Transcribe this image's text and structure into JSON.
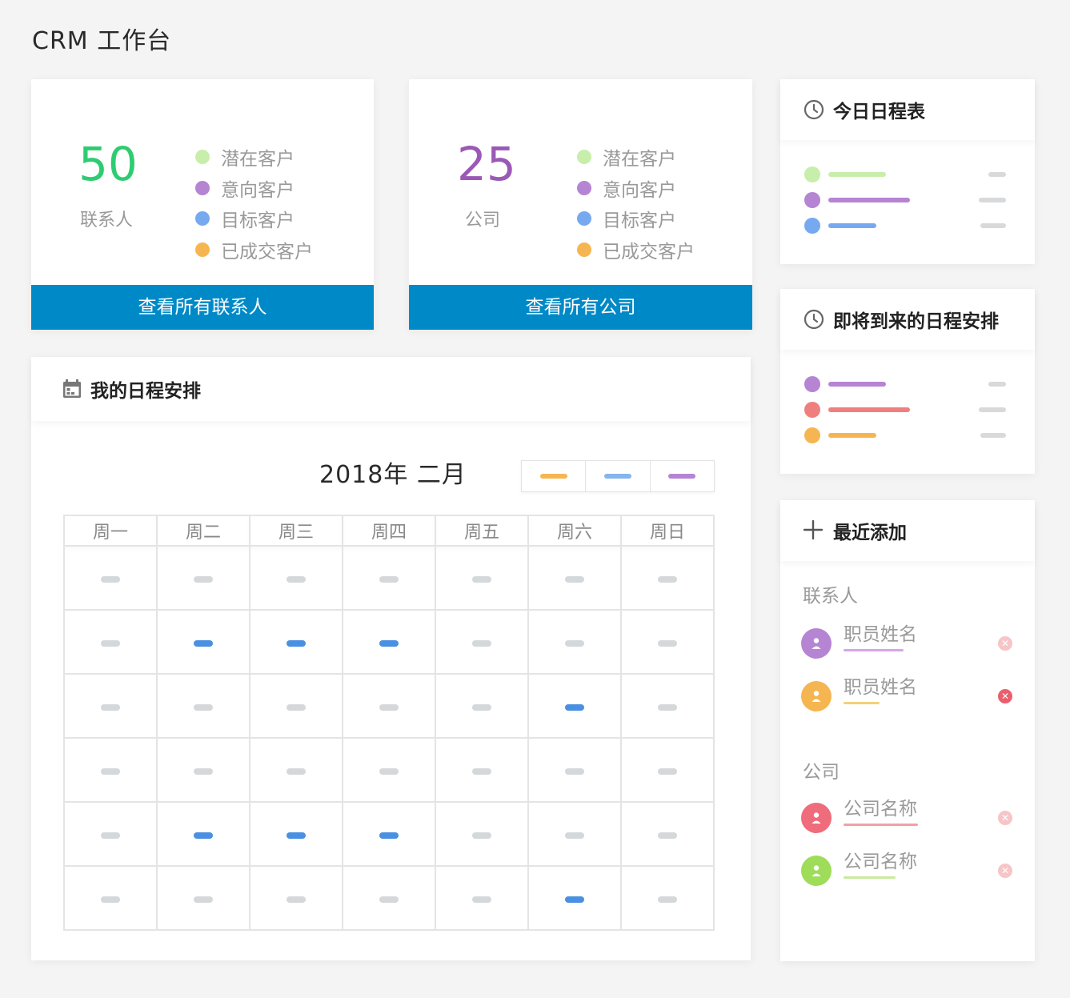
{
  "app": {
    "title": "CRM 工作台"
  },
  "contacts_card": {
    "count": "50",
    "label": "联系人",
    "count_color": "#2ecc71",
    "legend": [
      {
        "label": "潜在客户",
        "color": "#c8eeab"
      },
      {
        "label": "意向客户",
        "color": "#b584d3"
      },
      {
        "label": "目标客户",
        "color": "#76a9f0"
      },
      {
        "label": "已成交客户",
        "color": "#f5b652"
      }
    ],
    "button": "查看所有联系人"
  },
  "companies_card": {
    "count": "25",
    "label": "公司",
    "count_color": "#9b59b6",
    "legend": [
      {
        "label": "潜在客户",
        "color": "#c8eeab"
      },
      {
        "label": "意向客户",
        "color": "#b584d3"
      },
      {
        "label": "目标客户",
        "color": "#76a9f0"
      },
      {
        "label": "已成交客户",
        "color": "#f5b652"
      }
    ],
    "button": "查看所有公司"
  },
  "today_schedule": {
    "title": "今日日程表",
    "icon": "clock-icon",
    "rows": [
      {
        "color": "#c8eeab"
      },
      {
        "color": "#b584d3"
      },
      {
        "color": "#76a9f0"
      }
    ]
  },
  "upcoming_schedule": {
    "title": "即将到来的日程安排",
    "icon": "clock-icon",
    "rows": [
      {
        "color": "#b584d3"
      },
      {
        "color": "#ef7f7f"
      },
      {
        "color": "#f5b652"
      }
    ]
  },
  "my_schedule": {
    "title": "我的日程安排",
    "icon": "calendar-icon",
    "month": "2018年 二月",
    "legend_colors": [
      "#f5b652",
      "#86b4ec",
      "#b584d3"
    ],
    "weekdays": [
      "周一",
      "周二",
      "周三",
      "周四",
      "周五",
      "周六",
      "周日"
    ],
    "busy": [
      [
        0,
        0,
        0,
        0,
        0,
        0,
        0
      ],
      [
        0,
        1,
        1,
        1,
        0,
        0,
        0
      ],
      [
        0,
        0,
        0,
        0,
        0,
        1,
        0
      ],
      [
        0,
        0,
        0,
        0,
        0,
        0,
        0
      ],
      [
        0,
        1,
        1,
        1,
        0,
        0,
        0
      ],
      [
        0,
        0,
        0,
        0,
        0,
        1,
        0
      ]
    ]
  },
  "recent": {
    "title": "最近添加",
    "icon": "plus-icon",
    "contacts_label": "联系人",
    "contacts": [
      {
        "name": "职员姓名",
        "avatar_color": "#b584d3",
        "underline_color": "#d4a8e6",
        "remove_color": "#f6c5c8"
      },
      {
        "name": "职员姓名",
        "avatar_color": "#f5b652",
        "underline_color": "#f5d07a",
        "remove_color": "#ea5f6d"
      }
    ],
    "companies_label": "公司",
    "companies": [
      {
        "name": "公司名称",
        "avatar_color": "#ee6c7b",
        "underline_color": "#f0a0a8",
        "remove_color": "#f6c5c8"
      },
      {
        "name": "公司名称",
        "avatar_color": "#9fdc59",
        "underline_color": "#c8eaa0",
        "remove_color": "#f6c5c8"
      }
    ]
  }
}
